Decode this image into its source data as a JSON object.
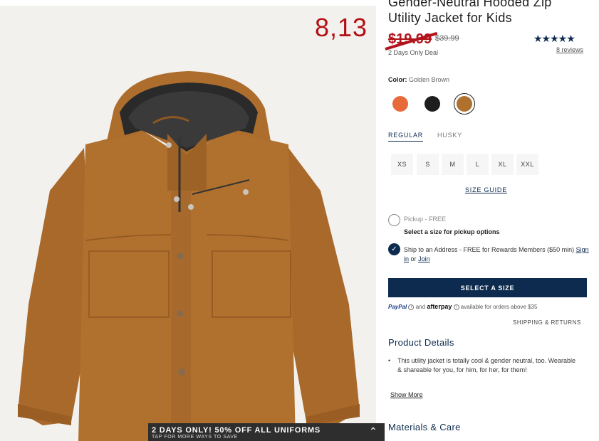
{
  "annotation": "8,13",
  "product": {
    "title": "Gender-Neutral Hooded Zip Utility Jacket for Kids",
    "sale_price": "$19.99",
    "original_price": "$39.99",
    "deal_note": "2 Days Only Deal",
    "rating_stars": "★★★★★",
    "rating_value": 4.5,
    "reviews": "8 reviews"
  },
  "color": {
    "label": "Color:",
    "selected": "Golden Brown",
    "swatches": [
      {
        "name": "orange",
        "hex": "#e8693a"
      },
      {
        "name": "black",
        "hex": "#1e1e1e"
      },
      {
        "name": "golden-brown",
        "hex": "#b0702e"
      }
    ]
  },
  "fit_tabs": [
    "REGULAR",
    "HUSKY"
  ],
  "sizes": [
    "XS",
    "S",
    "M",
    "L",
    "XL",
    "XXL"
  ],
  "size_guide": "SIZE GUIDE",
  "pickup": {
    "label": "Pickup - FREE",
    "sub": "Select a size for pickup options"
  },
  "ship": {
    "text": "Ship to an Address - FREE for Rewards Members ($50 min)",
    "sign_in": "Sign in",
    "or": "or",
    "join": "Join"
  },
  "select_size_button": "SELECT A SIZE",
  "payment": {
    "paypal": "PayPal",
    "and": "and",
    "afterpay": "afterpay",
    "note": "available for orders above $35"
  },
  "shipping_returns": "SHIPPING & RETURNS",
  "details": {
    "title": "Product Details",
    "bullet": "This utility jacket is totally cool & gender neutral, too. Wearable & shareable for you, for him, for her, for them!",
    "show_more": "Show More"
  },
  "materials_title": "Materials & Care",
  "promo": {
    "main": "2 DAYS ONLY! 50% OFF ALL UNIFORMS",
    "sub": "TAP FOR MORE WAYS TO SAVE"
  },
  "colors": {
    "navy": "#0d2b4e",
    "sale_red": "#b3141b",
    "jacket": "#b0702e"
  }
}
